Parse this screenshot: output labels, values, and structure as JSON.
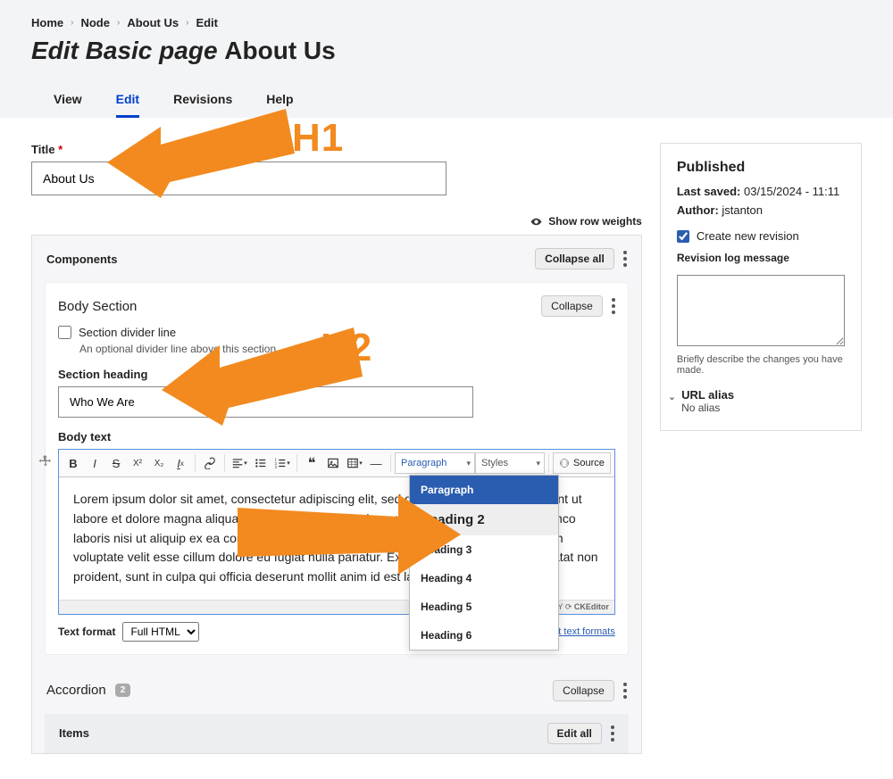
{
  "breadcrumb": [
    "Home",
    "Node",
    "About Us",
    "Edit"
  ],
  "page_title_prefix": "Edit Basic page",
  "page_title_name": "About Us",
  "tabs": [
    "View",
    "Edit",
    "Revisions",
    "Help"
  ],
  "active_tab": 1,
  "title_label": "Title",
  "title_value": "About Us",
  "show_row_weights": "Show row weights",
  "components": {
    "label": "Components",
    "collapse_all": "Collapse all"
  },
  "body_section": {
    "label": "Body Section",
    "collapse": "Collapse",
    "divider_label": "Section divider line",
    "divider_help": "An optional divider line above this section.",
    "heading_label": "Section heading",
    "heading_value": "Who We Are",
    "body_label": "Body text"
  },
  "toolbar": {
    "paragraph": "Paragraph",
    "styles": "Styles",
    "source": "Source"
  },
  "heading_options": [
    "Paragraph",
    "Heading 2",
    "Heading 3",
    "Heading 4",
    "Heading 5",
    "Heading 6"
  ],
  "editor_text": "Lorem ipsum dolor sit amet, consectetur adipiscing elit, sed do eiusmod tempor incididunt ut labore et dolore magna aliqua. Ut enim ad minim veniam, quis nostrud exercitation ullamco laboris nisi ut aliquip ex ea commodo consequat. Duis aute irure dolor in reprehenderit in voluptate velit esse cillum dolore eu fugiat nulla pariatur. Excepteur sint occaecat cupidatat non proident, sunt in culpa qui officia deserunt mollit anim id est laborum.",
  "editor_footer": {
    "powered": "POWERED BY",
    "ck": "CKEditor"
  },
  "text_format": {
    "label": "Text format",
    "value": "Full HTML"
  },
  "about_text_formats": "About text formats",
  "accordion": {
    "label": "Accordion",
    "count": "2",
    "collapse": "Collapse",
    "items": "Items",
    "edit_all": "Edit all"
  },
  "sidebar": {
    "status": "Published",
    "last_saved_label": "Last saved:",
    "last_saved_value": "03/15/2024 - 11:11",
    "author_label": "Author:",
    "author_value": "jstanton",
    "create_rev": "Create new revision",
    "rev_log_label": "Revision log message",
    "rev_help": "Briefly describe the changes you have made.",
    "url_alias": "URL alias",
    "no_alias": "No alias"
  },
  "annotations": {
    "h1": "H1",
    "h2": "H2"
  }
}
